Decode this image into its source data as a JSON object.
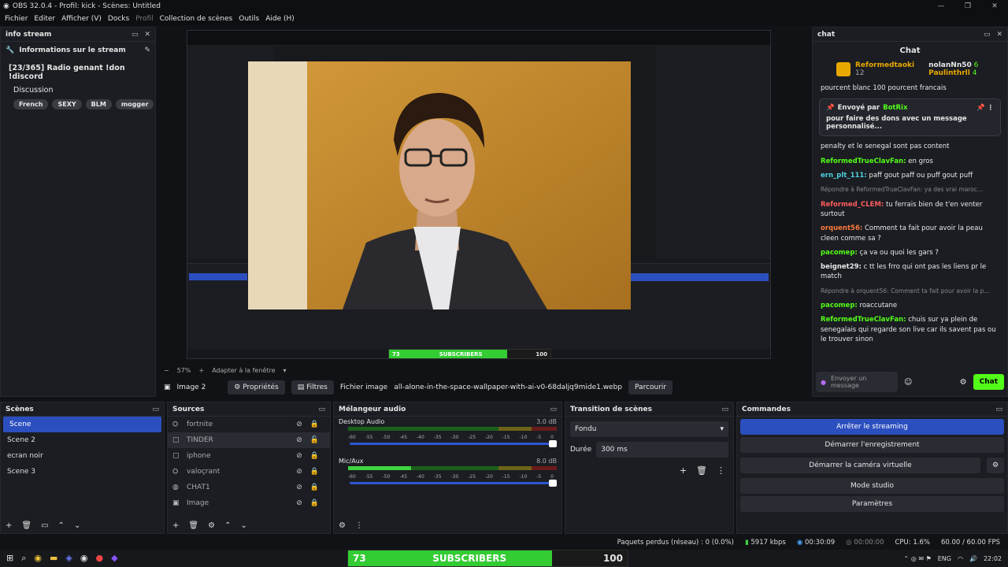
{
  "window": {
    "title": "OBS 32.0.4 - Profil: kick - Scènes: Untitled",
    "controls": [
      "—",
      "❐",
      "✕"
    ]
  },
  "menu": [
    "Fichier",
    "Editer",
    "Afficher (V)",
    "Docks",
    "Profil",
    "Collection de scènes",
    "Outils",
    "Aide (H)"
  ],
  "info_dock": {
    "title": "info stream",
    "heading": "Informations sur le stream",
    "stream_title": "[23/365] Radio genant !don !discord",
    "category": "Discussion",
    "tags": [
      "French",
      "SEXY",
      "BLM",
      "mogger"
    ]
  },
  "preview": {
    "zoom": "57%",
    "fit_label": "Adapter à la fenêtre",
    "subscribers": {
      "left": "73",
      "label": "SUBSCRIBERS",
      "right": "100",
      "fill_fraction": 0.73
    }
  },
  "propbar": {
    "source": "Image 2",
    "properties": "Propriétés",
    "filters": "Filtres",
    "file_label": "Fichier image",
    "file_value": "all-alone-in-the-space-wallpaper-with-ai-v0-68daljq9mide1.webp",
    "browse": "Parcourir"
  },
  "chat": {
    "dock_title": "chat",
    "header": "Chat",
    "top": [
      {
        "name": "Reformedtaoki",
        "count": "12"
      },
      {
        "name": "nolanNn50",
        "count": "6"
      },
      {
        "name": "Paulinthrll",
        "count": "4"
      }
    ],
    "truncated_line": "pourcent blanc 100 pourcent francais",
    "pinned": {
      "prefix": "Envoyé par",
      "sender": "BotRix",
      "text": "pour faire des dons avec un message personnalisé..."
    },
    "messages": [
      {
        "name": "",
        "text": "penalty et le senegal sont pas content",
        "color": "#e8e8e8",
        "dim": false
      },
      {
        "name": "ReformedTrueClavFan:",
        "text": "en gros",
        "color": "#53fc18",
        "dim": false
      },
      {
        "name": "ern_plt_111:",
        "text": "paff gout paff ou puff gout puff",
        "color": "#4fd0e0",
        "dim": false
      },
      {
        "name": "",
        "text": "Répondre à ReformedTrueClavFan: ya des vrai maroc...",
        "color": "#888",
        "dim": true
      },
      {
        "name": "Reformed_CLEM:",
        "text": "tu ferrais bien de t'en venter surtout",
        "color": "#ff5c5c",
        "dim": false
      },
      {
        "name": "orquent56:",
        "text": "Comment ta fait pour avoir la peau cleen comme sa ?",
        "color": "#ff7a3d",
        "dim": false
      },
      {
        "name": "pacomep:",
        "text": "ça va ou quoi les gars ?",
        "color": "#53fc18",
        "dim": false
      },
      {
        "name": "beignet29:",
        "text": "c tt les frro qui ont pas les liens pr le match",
        "color": "#e8e8e8",
        "dim": false
      },
      {
        "name": "",
        "text": "Répondre à orquent56: Comment ta fait pour avoir la p...",
        "color": "#888",
        "dim": true
      },
      {
        "name": "pacomep:",
        "text": "roaccutane",
        "color": "#53fc18",
        "dim": false
      },
      {
        "name": "ReformedTrueClavFan:",
        "text": "chuis sur ya plein de senegalais qui regarde son live car ils savent pas ou le trouver sinon",
        "color": "#53fc18",
        "dim": false
      }
    ],
    "input_placeholder": "Envoyer un message",
    "send": "Chat"
  },
  "scenes": {
    "title": "Scènes",
    "items": [
      "Scene",
      "Scene 2",
      "ecran noir",
      "Scene 3"
    ],
    "selected": 0
  },
  "sources": {
    "title": "Sources",
    "items": [
      "fortnite",
      "TINDER",
      "iphone",
      "valoçrant",
      "CHAT1",
      "Image"
    ]
  },
  "mixer": {
    "title": "Mélangeur audio",
    "channels": [
      {
        "name": "Desktop Audio",
        "db": "3.0 dB",
        "level": 0.0
      },
      {
        "name": "Mic/Aux",
        "db": "8.0 dB",
        "level": 0.3
      }
    ],
    "ticks": [
      "-60",
      "-55",
      "-50",
      "-45",
      "-40",
      "-35",
      "-30",
      "-25",
      "-20",
      "-15",
      "-10",
      "-5",
      "0"
    ]
  },
  "transition": {
    "title": "Transition de scènes",
    "type": "Fondu",
    "duration_label": "Durée",
    "duration": "300 ms"
  },
  "commands": {
    "title": "Commandes",
    "buttons": [
      "Arrêter le streaming",
      "Démarrer l'enregistrement",
      "Démarrer la caméra virtuelle",
      "Mode studio",
      "Paramètres"
    ]
  },
  "status": {
    "dropped": "Paquets perdus (réseau) : 0 (0.0%)",
    "bitrate": "5917 kbps",
    "stream_time": "00:30:09",
    "rec_time": "00:00:00",
    "cpu": "CPU: 1.6%",
    "fps": "60.00 / 60.00 FPS"
  },
  "taskbar": {
    "lang": "ENG",
    "time": "22:02"
  }
}
